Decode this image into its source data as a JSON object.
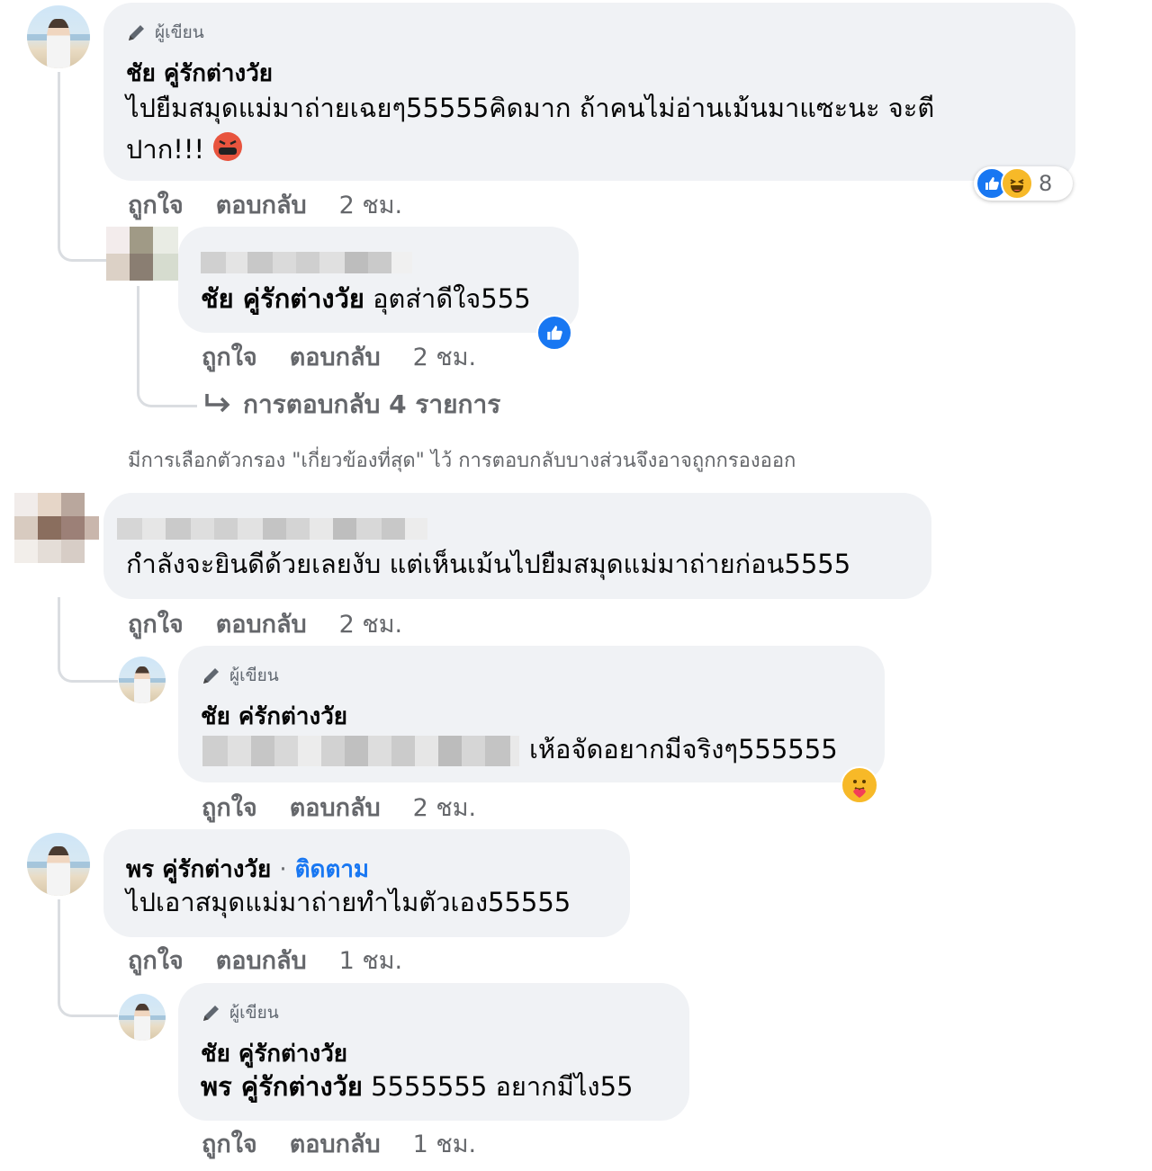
{
  "comment1": {
    "badge": "ผู้เขียน",
    "name": "ชัย คู่รักต่างวัย",
    "text_line1": "ไปยืมสมุดแม่มาถ่ายเฉยๆ55555คิดมาก ถ้าคนไม่อ่านเม้นมาแซะนะ จะตี",
    "text_line2": "ปาก!!!",
    "reaction_count": "8",
    "like": "ถูกใจ",
    "reply": "ตอบกลับ",
    "time": "2 ชม."
  },
  "reply1": {
    "tagged_name": "ชัย คู่รักต่างวัย",
    "text": "อุตส่าดีใจ555",
    "like": "ถูกใจ",
    "reply": "ตอบกลับ",
    "time": "2 ชม."
  },
  "more_replies": "การตอบกลับ 4 รายการ",
  "filter_note": "มีการเลือกตัวกรอง \"เกี่ยวข้องที่สุด\" ไว้ การตอบกลับบางส่วนจึงอาจถูกกรองออก",
  "comment2": {
    "text": "กำลังจะยินดีด้วยเลยงับ แต่เห็นเม้นไปยืมสมุดแม่มาถ่ายก่อน5555",
    "like": "ถูกใจ",
    "reply": "ตอบกลับ",
    "time": "2 ชม."
  },
  "reply2": {
    "badge": "ผู้เขียน",
    "name": "ชัย ค่รักต่างวัย",
    "text": "เห้อจัดอยากมีจริงๆ555555",
    "like": "ถูกใจ",
    "reply": "ตอบกลับ",
    "time": "2 ชม."
  },
  "comment3": {
    "name": "พร คู่รักต่างวัย",
    "separator": "·",
    "follow": "ติดตาม",
    "text": "ไปเอาสมุดแม่มาถ่ายทำไมตัวเอง55555",
    "like": "ถูกใจ",
    "reply": "ตอบกลับ",
    "time": "1 ชม."
  },
  "reply3": {
    "badge": "ผู้เขียน",
    "name": "ชัย คู่รักต่างวัย",
    "tagged_name": "พร คู่รักต่างวัย",
    "text": "5555555 อยากมีไง55",
    "like": "ถูกใจ",
    "reply": "ตอบกลับ",
    "time": "1 ชม."
  },
  "colors": {
    "bubble": "#f0f2f5",
    "secondary_text": "#65676b",
    "link_blue": "#1877f2",
    "like_blue": "#1877f2",
    "haha_yellow": "#f7b928"
  }
}
